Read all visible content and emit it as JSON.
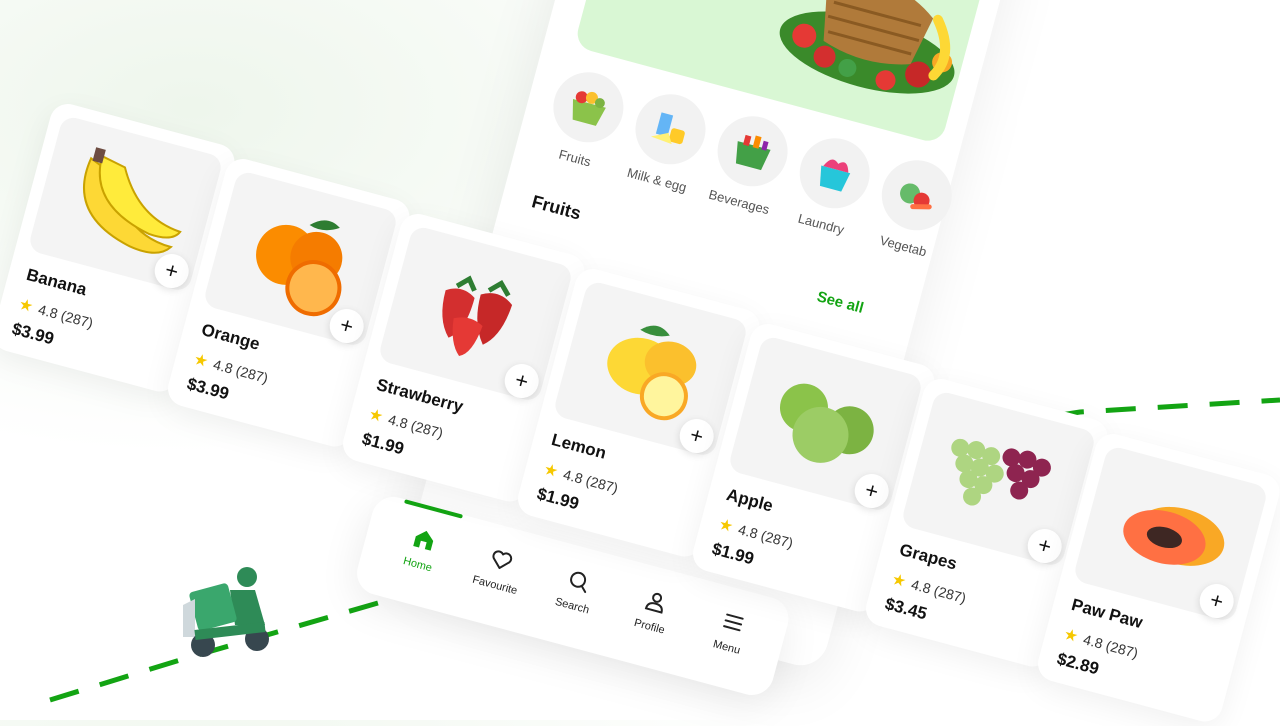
{
  "categories": [
    {
      "label": "Fruits",
      "icon": "fruit-basket-icon"
    },
    {
      "label": "Milk & egg",
      "icon": "milk-egg-icon"
    },
    {
      "label": "Beverages",
      "icon": "beverages-basket-icon"
    },
    {
      "label": "Laundry",
      "icon": "laundry-basket-icon"
    },
    {
      "label": "Vegetab",
      "icon": "vegetables-icon"
    }
  ],
  "section": {
    "title": "Fruits",
    "see_all": "See all"
  },
  "products": [
    {
      "name": "Banana",
      "rating": "4.8 (287)",
      "price": "$3.99",
      "add": "+"
    },
    {
      "name": "Orange",
      "rating": "4.8 (287)",
      "price": "$3.99",
      "add": "+"
    },
    {
      "name": "Strawberry",
      "rating": "4.8 (287)",
      "price": "$1.99",
      "add": "+"
    },
    {
      "name": "Lemon",
      "rating": "4.8 (287)",
      "price": "$1.99",
      "add": "+"
    },
    {
      "name": "Apple",
      "rating": "4.8 (287)",
      "price": "$1.99",
      "add": "+"
    },
    {
      "name": "Grapes",
      "rating": "4.8 (287)",
      "price": "$3.45",
      "add": "+"
    },
    {
      "name": "Paw Paw",
      "rating": "4.8 (287)",
      "price": "$2.89",
      "add": "+"
    }
  ],
  "nav": [
    {
      "label": "Home",
      "icon": "home-icon",
      "active": true
    },
    {
      "label": "Favourite",
      "icon": "heart-icon",
      "active": false
    },
    {
      "label": "Search",
      "icon": "search-icon",
      "active": false
    },
    {
      "label": "Profile",
      "icon": "profile-icon",
      "active": false
    },
    {
      "label": "Menu",
      "icon": "menu-icon",
      "active": false
    }
  ],
  "colors": {
    "accent": "#13a413",
    "star": "#f6c800",
    "banner": "#d9f7d4"
  }
}
